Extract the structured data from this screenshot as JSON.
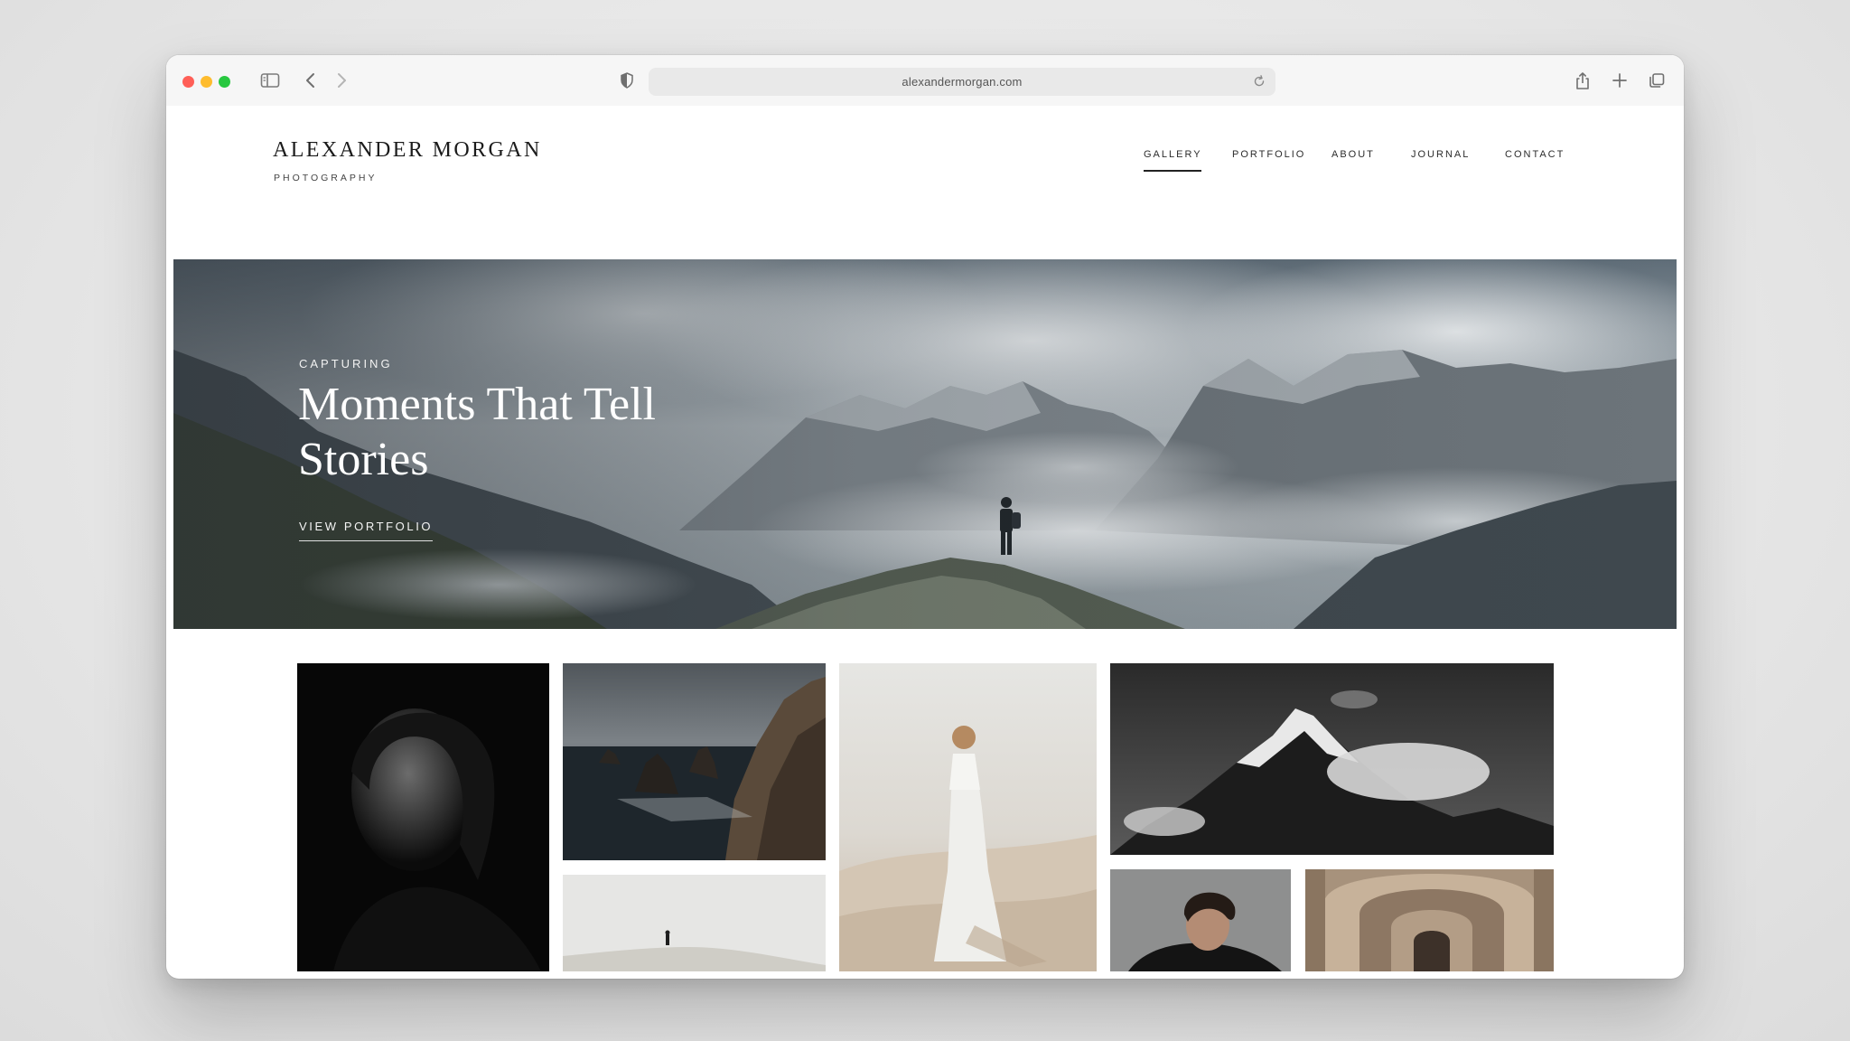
{
  "browser": {
    "url": "alexandermorgan.com",
    "icons": [
      "sidebar-icon",
      "back-icon",
      "forward-icon",
      "privacy-shield-icon",
      "reload-icon",
      "share-icon",
      "new-tab-icon",
      "tabs-overview-icon"
    ]
  },
  "site": {
    "brand_name": "ALEXANDER MORGAN",
    "brand_sub": "PHOTOGRAPHY",
    "nav": [
      {
        "label": "GALLERY",
        "active": true
      },
      {
        "label": "PORTFOLIO",
        "active": false
      },
      {
        "label": "ABOUT",
        "active": false
      },
      {
        "label": "JOURNAL",
        "active": false
      },
      {
        "label": "CONTACT",
        "active": false
      }
    ]
  },
  "hero": {
    "eyebrow": "CAPTURING",
    "title": "Moments That Tell Stories",
    "cta": "VIEW PORTFOLIO"
  },
  "gallery": {
    "photos": [
      {
        "name": "photo-portrait-woman",
        "subject": "black and white portrait of a woman"
      },
      {
        "name": "photo-coastal-cliffs",
        "subject": "sea stacks and coastal cliffs"
      },
      {
        "name": "photo-woman-desert",
        "subject": "woman in white dress on sand dunes"
      },
      {
        "name": "photo-snowy-peak",
        "subject": "black and white snowy mountain peak"
      },
      {
        "name": "photo-lone-figure-dunes",
        "subject": "lone figure on misty dune"
      },
      {
        "name": "photo-portrait-man",
        "subject": "portrait of a man with curly hair"
      },
      {
        "name": "photo-arched-corridor",
        "subject": "arched stone corridor"
      }
    ]
  },
  "colors": {
    "accent": "#222222",
    "page_background": "#ffffff",
    "browser_chrome": "#f6f6f6"
  }
}
